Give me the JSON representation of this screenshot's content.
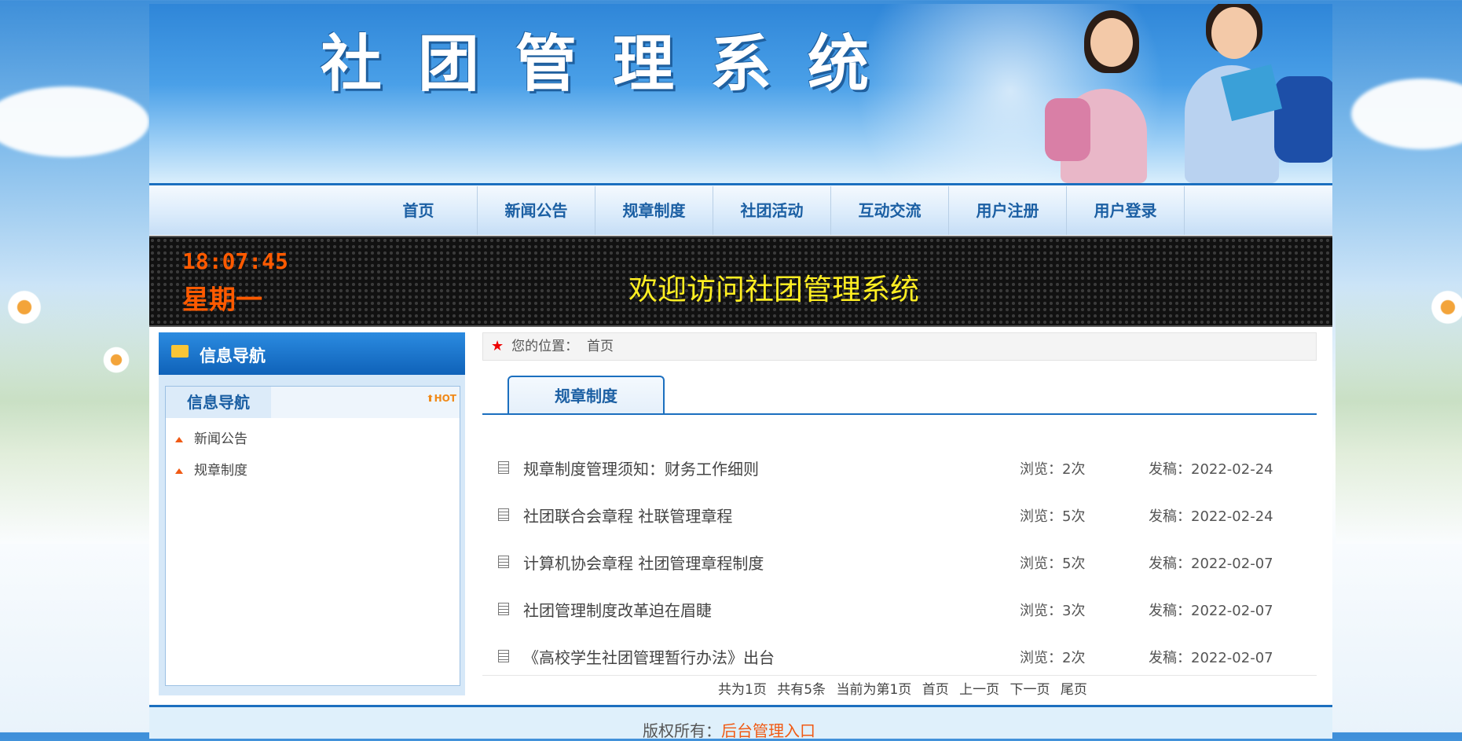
{
  "header": {
    "site_title": "社团管理系统"
  },
  "nav": {
    "items": [
      "首页",
      "新闻公告",
      "规章制度",
      "社团活动",
      "互动交流",
      "用户注册",
      "用户登录"
    ]
  },
  "ticker": {
    "time": "18:07:45",
    "weekday": "星期一",
    "welcome": "欢迎访问社团管理系统"
  },
  "sidebar": {
    "header": "信息导航",
    "tab": "信息导航",
    "hot_label": "HOT",
    "items": [
      "新闻公告",
      "规章制度"
    ]
  },
  "main": {
    "breadcrumb_label": "您的位置：",
    "breadcrumb_value": "首页",
    "tab": "规章制度",
    "articles": [
      {
        "title": "规章制度管理须知：财务工作细则",
        "views": "浏览：2次",
        "date": "发稿：2022-02-24"
      },
      {
        "title": "社团联合会章程 社联管理章程",
        "views": "浏览：5次",
        "date": "发稿：2022-02-24"
      },
      {
        "title": "计算机协会章程 社团管理章程制度",
        "views": "浏览：5次",
        "date": "发稿：2022-02-07"
      },
      {
        "title": "社团管理制度改革迫在眉睫",
        "views": "浏览：3次",
        "date": "发稿：2022-02-07"
      },
      {
        "title": "《高校学生社团管理暂行办法》出台",
        "views": "浏览：2次",
        "date": "发稿：2022-02-07"
      }
    ],
    "pager": {
      "total_pages": "共为1页",
      "total_items": "共有5条",
      "current": "当前为第1页",
      "first": "首页",
      "prev": "上一页",
      "next": "下一页",
      "last": "尾页"
    }
  },
  "footer": {
    "copyright_prefix": "版权所有：",
    "copyright_link": "后台管理入口"
  }
}
